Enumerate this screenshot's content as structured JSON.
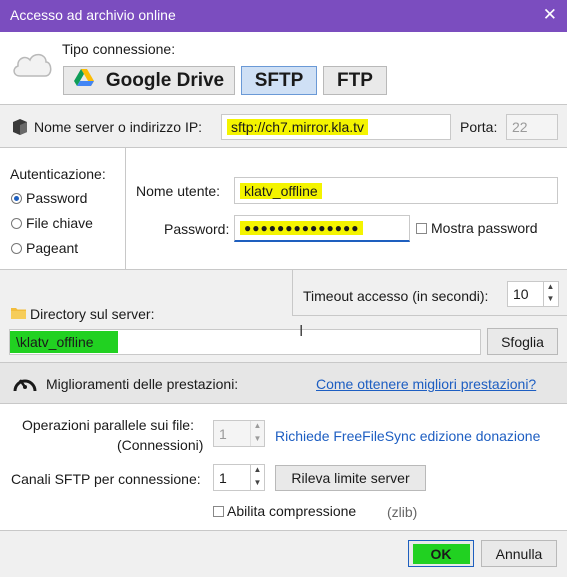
{
  "window": {
    "title": "Accesso ad archivio online",
    "close_glyph": "✕"
  },
  "connection": {
    "label": "Tipo connessione:",
    "types": [
      {
        "label": "Google Drive",
        "selected": false
      },
      {
        "label": "SFTP",
        "selected": true
      },
      {
        "label": "FTP",
        "selected": false
      }
    ]
  },
  "server": {
    "label": "Nome server o indirizzo IP:",
    "value": "sftp://ch7.mirror.kla.tv",
    "port_label": "Porta:",
    "port_value": "22"
  },
  "auth": {
    "label": "Autenticazione:",
    "options": [
      {
        "label": "Password",
        "selected": true
      },
      {
        "label": "File chiave",
        "selected": false
      },
      {
        "label": "Pageant",
        "selected": false
      }
    ],
    "username_label": "Nome utente:",
    "username_value": "klatv_offline",
    "password_label": "Password:",
    "password_value": "●●●●●●●●●●●●●●",
    "show_password_label": "Mostra password"
  },
  "timeout": {
    "label": "Timeout accesso (in secondi):",
    "value": "10"
  },
  "directory": {
    "label": "Directory sul server:",
    "value": "\\klatv_offline",
    "browse_label": "Sfoglia"
  },
  "performance": {
    "label": "Miglioramenti delle prestazioni:",
    "link": "Come ottenere migliori prestazioni?",
    "parallel_label_1": "Operazioni parallele sui file:",
    "parallel_label_2": "(Connessioni)",
    "parallel_value": "1",
    "donation_link": "Richiede FreeFileSync edizione donazione",
    "channels_label": "Canali SFTP per connessione:",
    "channels_value": "1",
    "detect_limit_label": "Rileva limite server",
    "compression_label": "Abilita compressione",
    "compression_note": "(zlib)"
  },
  "footer": {
    "ok_label": "OK",
    "cancel_label": "Annulla"
  },
  "colors": {
    "titlebar": "#7b4dbf",
    "highlight_yellow": "#f4f400",
    "highlight_green": "#21d121",
    "link": "#1d5ec2"
  }
}
